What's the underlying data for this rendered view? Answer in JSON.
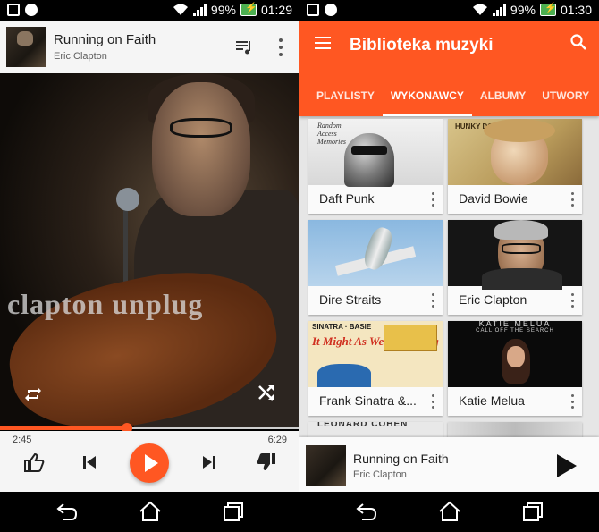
{
  "status_left": {
    "time": "01:29",
    "battery": "99%"
  },
  "status_right": {
    "time": "01:30",
    "battery": "99%"
  },
  "now_playing": {
    "title": "Running on Faith",
    "artist": "Eric Clapton",
    "art_text": "clapton unplug",
    "elapsed": "2:45",
    "total": "6:29",
    "progress": 0.424
  },
  "library": {
    "title": "Biblioteka muzyki",
    "tabs": [
      "PLAYLISTY",
      "WYKONAWCY",
      "ALBUMY",
      "UTWORY"
    ],
    "active_tab": 1,
    "artists": [
      {
        "name": "Daft Punk"
      },
      {
        "name": "David Bowie"
      },
      {
        "name": "Dire Straits"
      },
      {
        "name": "Eric Clapton"
      },
      {
        "name": "Frank Sinatra &..."
      },
      {
        "name": "Katie Melua"
      }
    ],
    "covers": {
      "daft_punk_script": "Random Access Memories",
      "bowie_script": "HUNKY DORY",
      "sinatra_title": "It Might As Well Be Swing",
      "sinatra_header": "SINATRA · BASIE",
      "melua_title": "KATIE MELUA",
      "melua_sub": "CALL OFF THE SEARCH",
      "cohen_partial": "LEONARD COHEN"
    }
  },
  "mini_player": {
    "title": "Running on Faith",
    "artist": "Eric Clapton"
  },
  "colors": {
    "accent": "#ff5722",
    "appbar": "#ff5722",
    "surface": "#fafafa"
  }
}
